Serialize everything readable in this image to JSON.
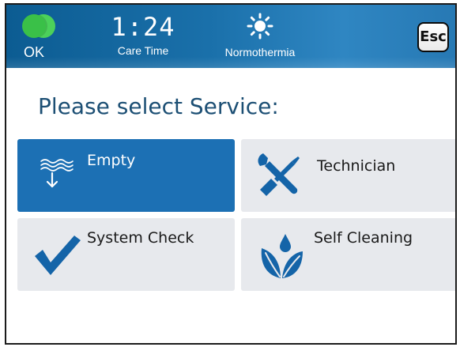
{
  "status_bar": {
    "status_label": "OK",
    "status_color": "#3ac048",
    "care_time": "1:24",
    "care_time_label": "Care Time",
    "mode_label": "Normothermia",
    "mode_icon": "sun-icon",
    "esc_label": "Esc"
  },
  "main": {
    "title": "Please select Service:",
    "tiles": [
      {
        "label": "Empty",
        "icon": "drain-waves-arrow-icon",
        "selected": true
      },
      {
        "label": "Technician",
        "icon": "tools-icon",
        "selected": false
      },
      {
        "label": "System Check",
        "icon": "checkmark-icon",
        "selected": false
      },
      {
        "label": "Self Cleaning",
        "icon": "leaves-drop-icon",
        "selected": false
      }
    ]
  },
  "colors": {
    "header_blue": "#1a70aa",
    "accent_blue": "#1c70b4",
    "title_blue": "#1c4f74",
    "tile_gray": "#e7e9ed",
    "icon_blue": "#1464a8"
  }
}
